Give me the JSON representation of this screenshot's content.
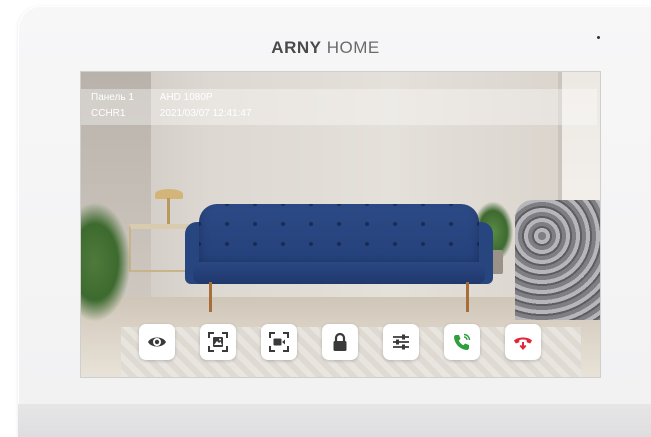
{
  "brand": {
    "bold": "ARNY",
    "light": "HOME"
  },
  "overlay": {
    "row1": {
      "label": "Панель 1",
      "value": "AHD 1080P"
    },
    "row2": {
      "label": "CCHR1",
      "value": "2021/03/07 12:41:47"
    }
  },
  "controls": [
    {
      "icon": "eye-icon"
    },
    {
      "icon": "photo-capture-icon"
    },
    {
      "icon": "video-record-icon"
    },
    {
      "icon": "lock-icon"
    },
    {
      "icon": "settings-sliders-icon"
    },
    {
      "icon": "answer-call-icon"
    },
    {
      "icon": "hangup-call-icon"
    }
  ],
  "colors": {
    "answer": "#2e9e3e",
    "hangup": "#e0263a",
    "icon": "#3a3a3a"
  }
}
